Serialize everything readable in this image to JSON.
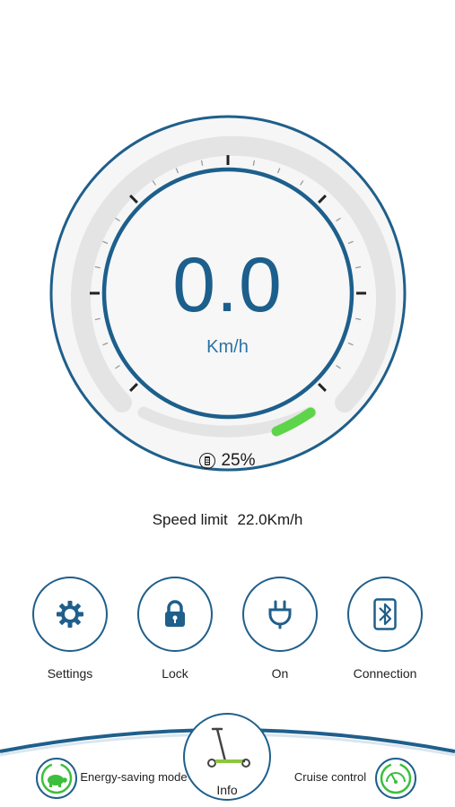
{
  "speedometer": {
    "speed": "0.0",
    "unit": "Km/h",
    "battery_percent": "25%",
    "battery_level": 0.25
  },
  "speed_limit": {
    "label": "Speed limit",
    "value": "22.0Km/h"
  },
  "controls": [
    {
      "label": "Settings",
      "icon": "gear-icon"
    },
    {
      "label": "Lock",
      "icon": "lock-icon"
    },
    {
      "label": "On",
      "icon": "headlight-icon"
    },
    {
      "label": "Connection",
      "icon": "bluetooth-icon"
    }
  ],
  "bottom_nav": {
    "energy_saving": "Energy-saving mode",
    "info": "Info",
    "cruise_control": "Cruise control"
  },
  "colors": {
    "primary": "#1f5f8b",
    "battery_green": "#5ed44a",
    "track_gray": "#e4e4e4"
  }
}
